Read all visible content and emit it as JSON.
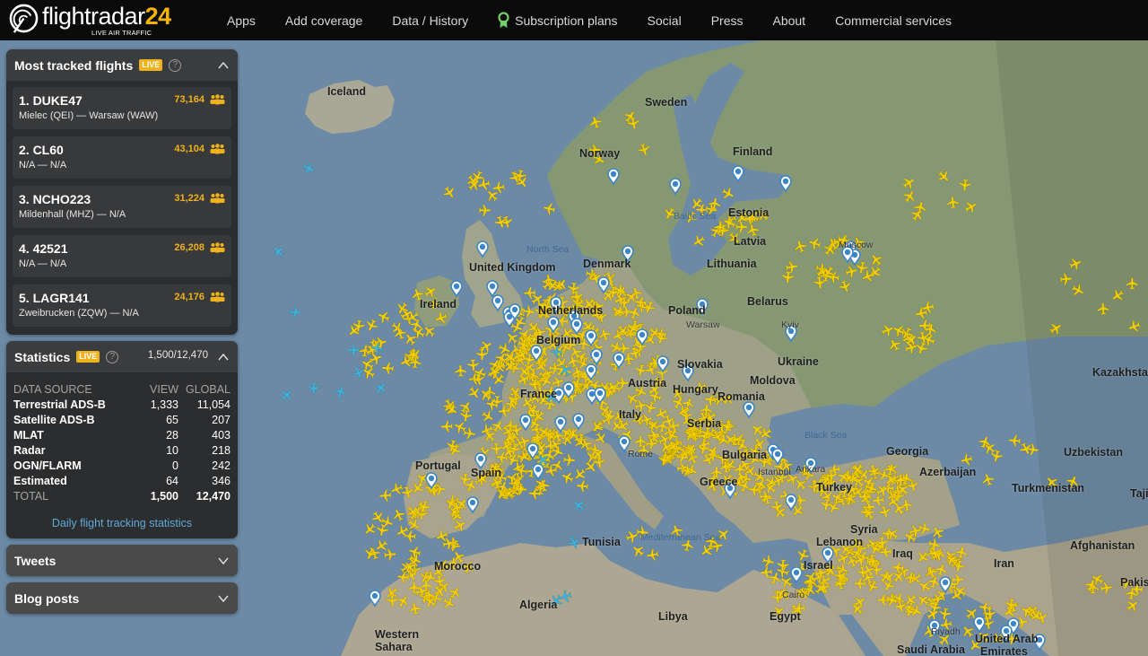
{
  "header": {
    "logo_text": "flightradar",
    "logo_number": "24",
    "logo_tagline": "LIVE AIR TRAFFIC",
    "nav": [
      {
        "label": "Apps",
        "icon": null
      },
      {
        "label": "Add coverage",
        "icon": null
      },
      {
        "label": "Data / History",
        "icon": null
      },
      {
        "label": "Subscription plans",
        "icon": "award-ribbon-icon"
      },
      {
        "label": "Social",
        "icon": null
      },
      {
        "label": "Press",
        "icon": null
      },
      {
        "label": "About",
        "icon": null
      },
      {
        "label": "Commercial services",
        "icon": null
      }
    ]
  },
  "colors": {
    "brand_yellow": "#f0b21a",
    "plane_yellow": "#f5d000",
    "plane_blue": "#3ab4e6",
    "pin_blue": "#3d86c6",
    "link_blue": "#5fa8d8",
    "ribbon_green": "#6fcf68",
    "water": "#6c8aa6",
    "land": "#a9a592",
    "land_green": "#869873"
  },
  "most_tracked": {
    "title": "Most tracked flights",
    "live_label": "LIVE",
    "help": "?",
    "flights": [
      {
        "rank": "1. DUKE47",
        "route": "Mielec (QEI) — Warsaw (WAW)",
        "count": "73,164"
      },
      {
        "rank": "2. CL60",
        "route": "N/A — N/A",
        "count": "43,104"
      },
      {
        "rank": "3. NCHO223",
        "route": "Mildenhall (MHZ) — N/A",
        "count": "31,224"
      },
      {
        "rank": "4. 42521",
        "route": "N/A — N/A",
        "count": "26,208"
      },
      {
        "rank": "5. LAGR141",
        "route": "Zweibrucken (ZQW) — N/A",
        "count": "24,176"
      }
    ]
  },
  "statistics": {
    "title": "Statistics",
    "live_label": "LIVE",
    "help": "?",
    "summary": "1,500/12,470",
    "columns": [
      "DATA SOURCE",
      "VIEW",
      "GLOBAL"
    ],
    "rows": [
      {
        "source": "Terrestrial ADS-B",
        "view": "1,333",
        "global": "11,054"
      },
      {
        "source": "Satellite ADS-B",
        "view": "65",
        "global": "207"
      },
      {
        "source": "MLAT",
        "view": "28",
        "global": "403"
      },
      {
        "source": "Radar",
        "view": "10",
        "global": "218"
      },
      {
        "source": "OGN/FLARM",
        "view": "0",
        "global": "242"
      },
      {
        "source": "Estimated",
        "view": "64",
        "global": "346"
      }
    ],
    "total": {
      "source": "TOTAL",
      "view": "1,500",
      "global": "12,470"
    },
    "link": "Daily flight tracking statistics"
  },
  "tweets": {
    "title": "Tweets"
  },
  "blog": {
    "title": "Blog posts"
  },
  "map": {
    "country_labels": [
      {
        "name": "Iceland",
        "type": "country"
      },
      {
        "name": "Sweden",
        "type": "country"
      },
      {
        "name": "Norway",
        "type": "country"
      },
      {
        "name": "Finland",
        "type": "country"
      },
      {
        "name": "Estonia",
        "type": "country"
      },
      {
        "name": "Latvia",
        "type": "country"
      },
      {
        "name": "Lithuania",
        "type": "country"
      },
      {
        "name": "Belarus",
        "type": "country"
      },
      {
        "name": "United Kingdom",
        "type": "country"
      },
      {
        "name": "Ireland",
        "type": "country"
      },
      {
        "name": "Denmark",
        "type": "country"
      },
      {
        "name": "Netherlands",
        "type": "country"
      },
      {
        "name": "Belgium",
        "type": "country"
      },
      {
        "name": "Poland",
        "type": "country"
      },
      {
        "name": "Ukraine",
        "type": "country"
      },
      {
        "name": "Moldova",
        "type": "country"
      },
      {
        "name": "Slovakia",
        "type": "country"
      },
      {
        "name": "Hungary",
        "type": "country"
      },
      {
        "name": "Romania",
        "type": "country"
      },
      {
        "name": "France",
        "type": "country"
      },
      {
        "name": "Austria",
        "type": "country"
      },
      {
        "name": "Italy",
        "type": "country"
      },
      {
        "name": "Serbia",
        "type": "country"
      },
      {
        "name": "Bulgaria",
        "type": "country"
      },
      {
        "name": "Greece",
        "type": "country"
      },
      {
        "name": "Portugal",
        "type": "country"
      },
      {
        "name": "Spain",
        "type": "country"
      },
      {
        "name": "Kazakhstan",
        "type": "country"
      },
      {
        "name": "Georgia",
        "type": "country"
      },
      {
        "name": "Azerbaijan",
        "type": "country"
      },
      {
        "name": "Uzbekistan",
        "type": "country"
      },
      {
        "name": "Turkmenistan",
        "type": "country"
      },
      {
        "name": "Taji",
        "type": "country"
      },
      {
        "name": "Turkey",
        "type": "country"
      },
      {
        "name": "Syria",
        "type": "country"
      },
      {
        "name": "Lebanon",
        "type": "country"
      },
      {
        "name": "Israel",
        "type": "country"
      },
      {
        "name": "Iraq",
        "type": "country"
      },
      {
        "name": "Iran",
        "type": "country"
      },
      {
        "name": "Afghanistan",
        "type": "country"
      },
      {
        "name": "Pakist",
        "type": "country"
      },
      {
        "name": "Tunisia",
        "type": "country"
      },
      {
        "name": "Morocco",
        "type": "country"
      },
      {
        "name": "Algeria",
        "type": "country"
      },
      {
        "name": "Libya",
        "type": "country"
      },
      {
        "name": "Egypt",
        "type": "country"
      },
      {
        "name": "Western",
        "type": "country"
      },
      {
        "name": "Sahara",
        "type": "country"
      },
      {
        "name": "Saudi Arabia",
        "type": "country"
      },
      {
        "name": "United Arab",
        "type": "country"
      },
      {
        "name": "Emirates",
        "type": "country"
      },
      {
        "name": "Baltic Sea",
        "type": "sea"
      },
      {
        "name": "North Sea",
        "type": "sea"
      },
      {
        "name": "Black Sea",
        "type": "sea"
      },
      {
        "name": "Mediterranean Sea",
        "type": "sea"
      },
      {
        "name": "Warsaw",
        "type": "city"
      },
      {
        "name": "Kyiv",
        "type": "city"
      },
      {
        "name": "Moscow",
        "type": "city"
      },
      {
        "name": "Istanbul",
        "type": "city"
      },
      {
        "name": "Ankara",
        "type": "city"
      },
      {
        "name": "Rome",
        "type": "city"
      },
      {
        "name": "Cairo",
        "type": "city"
      },
      {
        "name": "Riyadh",
        "type": "city"
      }
    ]
  }
}
